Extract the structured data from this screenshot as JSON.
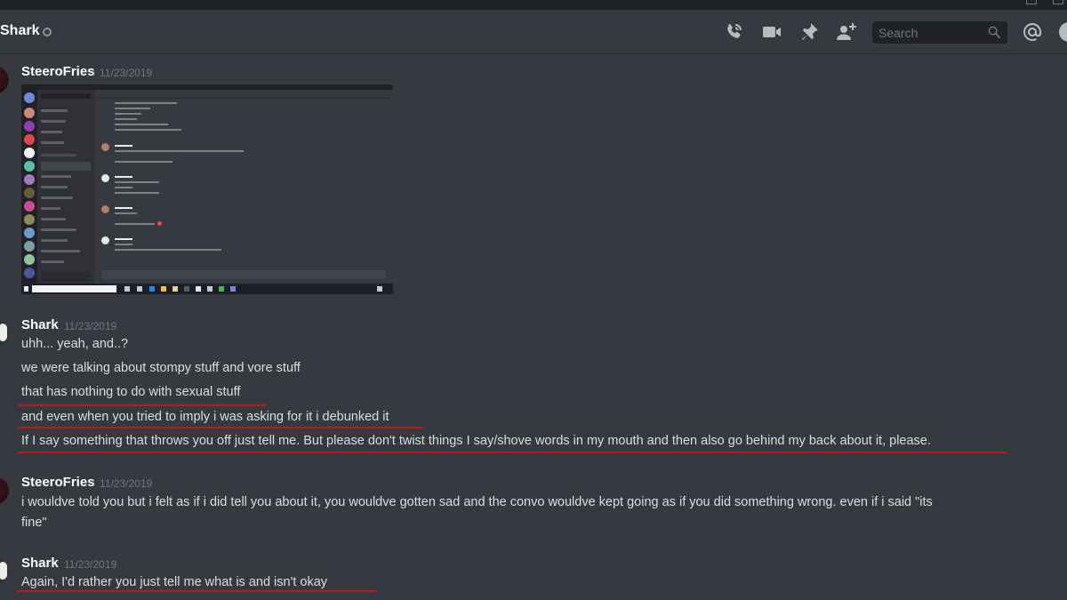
{
  "window": {
    "title_bar": ""
  },
  "header": {
    "channel_name": "Shark",
    "status": "offline",
    "icons": [
      "phone-call-icon",
      "video-icon",
      "pin-icon",
      "add-friend-icon",
      "mention-icon",
      "help-icon"
    ],
    "search": {
      "placeholder": "Search",
      "value": ""
    }
  },
  "messages": [
    {
      "author": "SteeroFries",
      "timestamp": "11/23/2019",
      "attachment": {
        "type": "screenshot",
        "description": "Discord DM screenshot with Shark",
        "heart_color": "#f04747"
      },
      "lines": []
    },
    {
      "author": "Shark",
      "timestamp": "11/23/2019",
      "lines": [
        {
          "text": "uhh... yeah, and..?",
          "underlined": false
        },
        {
          "text": "we were talking about stompy stuff and vore stuff",
          "underlined": false
        },
        {
          "text": "that has nothing to do with sexual stuff",
          "underlined": true
        },
        {
          "text": "and even when you tried to imply i was asking for it i debunked it",
          "underlined": true
        },
        {
          "text": "If I say something that throws you off just tell me. But please don't twist things I say/shove words in my mouth and then also go behind my back about it, please.",
          "underlined": true
        }
      ]
    },
    {
      "author": "SteeroFries",
      "timestamp": "11/23/2019",
      "lines": [
        {
          "text": "i wouldve told you but i felt as if i did tell you about it, you wouldve gotten sad and the convo wouldve kept going as if you did something wrong. even if i said \"its",
          "underlined": false
        },
        {
          "text": "fine\"",
          "underlined": false
        }
      ]
    },
    {
      "author": "Shark",
      "timestamp": "11/23/2019",
      "lines": [
        {
          "text": "Again, I'd rather you just tell me what is and isn't okay",
          "underlined": true
        }
      ]
    }
  ],
  "colors": {
    "background": "#36393f",
    "titlebar": "#202225",
    "underline": "#c0181b",
    "username": "#ffffff",
    "timestamp": "#72767d",
    "text": "#dcddde"
  }
}
